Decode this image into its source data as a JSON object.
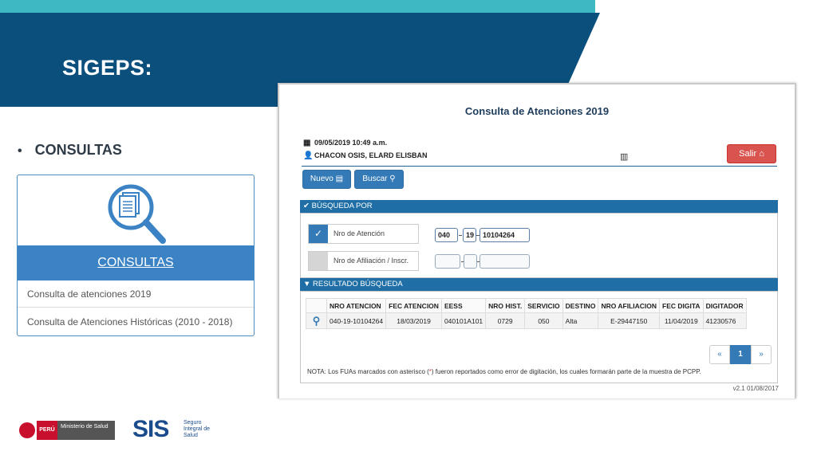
{
  "slide": {
    "title": "SIGEPS:",
    "bullet": "CONSULTAS"
  },
  "card": {
    "header": "CONSULTAS",
    "links": [
      "Consulta de atenciones 2019",
      "Consulta de Atenciones Históricas (2010 - 2018)"
    ]
  },
  "app": {
    "title": "Consulta de Atenciones 2019",
    "datetime": "09/05/2019 10:49 a.m.",
    "user": "CHACON OSIS, ELARD ELISBAN",
    "salir_label": "Salir",
    "nuevo_label": "Nuevo",
    "buscar_label": "Buscar",
    "section_busqueda": "BÚSQUEDA POR",
    "section_resultado": "RESULTADO BÚSQUEDA",
    "option_atencion": "Nro de Atención",
    "option_afiliacion": "Nro de Afiliación / Inscr.",
    "atencion_fields": [
      "040",
      "19",
      "10104264"
    ],
    "table": {
      "headers": [
        "NRO ATENCION",
        "FEC ATENCION",
        "EESS",
        "NRO HIST.",
        "SERVICIO",
        "DESTINO",
        "NRO AFILIACION",
        "FEC DIGITA",
        "DIGITADOR"
      ],
      "rows": [
        [
          "040-19-10104264",
          "18/03/2019",
          "040101A101",
          "0729",
          "050",
          "Alta",
          "E-29447150",
          "11/04/2019",
          "41230576"
        ]
      ]
    },
    "pager": {
      "prev": "«",
      "current": "1",
      "next": "»"
    },
    "nota_before": "NOTA: Los FUAs marcados con asterisco (",
    "nota_asterisk": "*",
    "nota_after": ") fueron reportados como error de digitación, los cuales formarán parte de la muestra de PCPP.",
    "version": "v2.1 01/08/2017"
  },
  "logos": {
    "peru": "PERÚ",
    "ministerio": "Ministerio de Salud",
    "sis": "SIS",
    "sis_sub": "Seguro Integral de Salud"
  },
  "colors": {
    "header_band": "#0b4f7c",
    "accent_teal": "#3eb9c4",
    "primary": "#337ab7",
    "danger": "#d9534f"
  }
}
